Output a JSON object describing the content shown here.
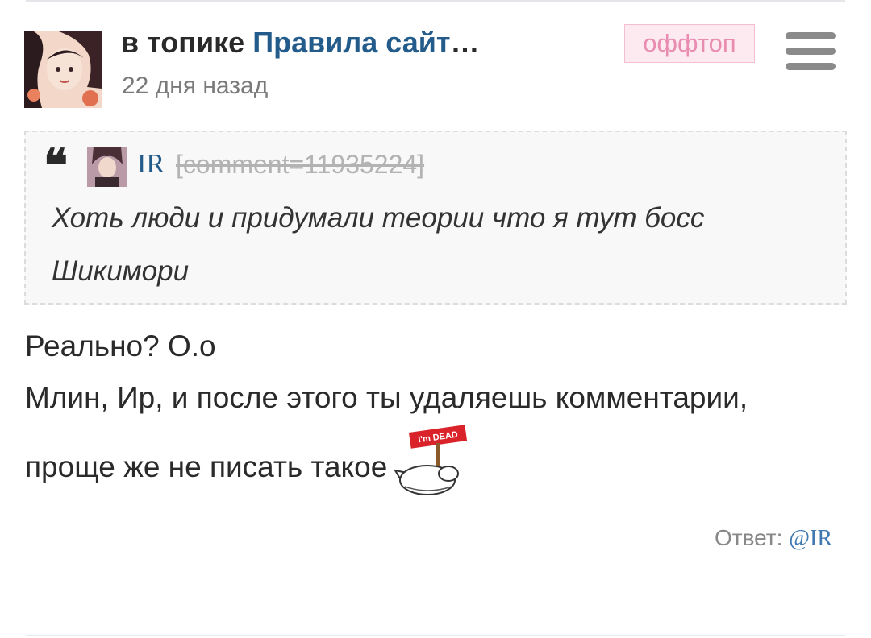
{
  "header": {
    "prefix": "в топике",
    "topic_link": "Правила сайт",
    "ellipsis": "…",
    "time": "22 дня назад",
    "badge": "оффтоп",
    "menu_icon": "hamburger-menu-icon"
  },
  "quote": {
    "icon": "quote-icon",
    "user": "IR",
    "ref": "[comment=11935224]",
    "text": "Хоть люди и придумали теории что я тут босс Шикимори"
  },
  "body": {
    "lines": [
      "Реально? О.о",
      "Млин, Ир, и после этого ты удаляешь комментарии,",
      "проще же не писать такое"
    ],
    "sticker_text": "I'm DEAD",
    "sticker_icon": "dead-sticker-icon"
  },
  "reply": {
    "label": "Ответ:",
    "link": "@IR"
  },
  "colors": {
    "link": "#235b8a",
    "badge_bg": "#fdeaf1",
    "badge_text": "#e98db0",
    "meta_gray": "#7a7a7a"
  }
}
